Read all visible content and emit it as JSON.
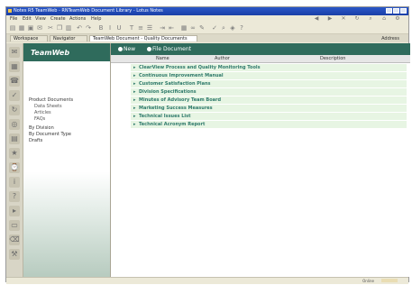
{
  "window": {
    "title": "Notes R5 TeamWeb - RNTeamWeb Document Library - Lotus Notes"
  },
  "menu": [
    "File",
    "Edit",
    "View",
    "Create",
    "Actions",
    "Help"
  ],
  "tabs": [
    {
      "label": "Workspace",
      "active": false
    },
    {
      "label": "Navigator",
      "active": false
    },
    {
      "label": "TeamWeb Document - Quality Documents",
      "active": true
    }
  ],
  "tabs_right": "Address",
  "navigator": {
    "title": "TeamWeb",
    "items": [
      {
        "label": "Product Documents",
        "level": 0
      },
      {
        "label": "Data Sheets",
        "level": 1
      },
      {
        "label": "Articles",
        "level": 1
      },
      {
        "label": "FAQs",
        "level": 1
      },
      {
        "label": "By Division",
        "level": 0
      },
      {
        "label": "By Document Type",
        "level": 0
      },
      {
        "label": "Drafts",
        "level": 0
      }
    ]
  },
  "main": {
    "actions": [
      "New",
      "File Document"
    ],
    "columns": [
      "Name",
      "Author",
      "Description"
    ],
    "rows": [
      "ClearView Process and Quality Monitoring Tools",
      "Continuous Improvement Manual",
      "Customer Satisfaction Plans",
      "Division Specifications",
      "Minutes of Advisory Team Board",
      "Marketing Success Measures",
      "Technical Issues List",
      "Technical Acronym Report"
    ]
  },
  "status": {
    "text": "Online"
  },
  "colors": {
    "accent": "#2f6b5c",
    "row_bg": "#e7f5e3",
    "row_text": "#2f7a6b",
    "titlebar": "#1a3fa7"
  }
}
